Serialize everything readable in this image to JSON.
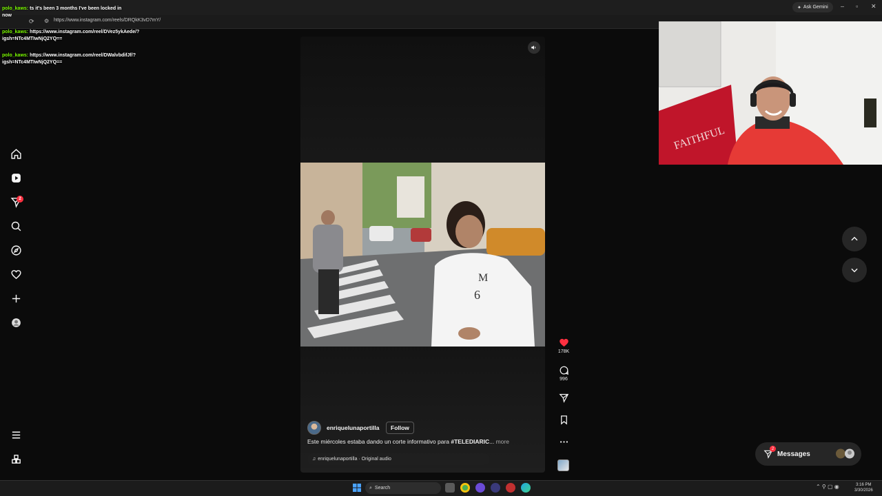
{
  "browser": {
    "url": "https://www.instagram.com/reels/DRQkK3vD7mY/",
    "ask_gemini": "Ask Gemini"
  },
  "chat": {
    "line1_user": "polo_kaws:",
    "line1_text": "ts it's been 3 months I've been locked in",
    "line1_wrap": "now",
    "line2_user": "polo_kaws:",
    "line2_text": "https://www.instagram.com/reel/DVez5ykAede/?",
    "line2_wrap": "igsh=NTc4MTIwNjQ2YQ==",
    "line3_user": "polo_kaws:",
    "line3_text": "https://www.instagram.com/reel/DWalvbdifJf/?",
    "line3_wrap": "igsh=NTc4MTIwNjQ2YQ=="
  },
  "nav": {
    "notifications_badge": "2"
  },
  "reel": {
    "author": "enriquelunaportilla",
    "follow_label": "Follow",
    "caption_text": "Este miércoles estaba dando un corte informativo para ",
    "caption_tag": "#TELEDIARIC",
    "caption_ellipsis": "...",
    "more_label": "more",
    "audio_label": "enriquelunaportilla · Original audio",
    "likes": "178K",
    "comments": "996"
  },
  "messages": {
    "label": "Messages",
    "badge": "2"
  },
  "taskbar": {
    "search_label": "Search",
    "time": "3:16 PM",
    "date": "3/30/2026"
  },
  "colors": {
    "like_red": "#ff3040",
    "background": "#0b0b0b",
    "chat_username": "#7cfc00"
  }
}
